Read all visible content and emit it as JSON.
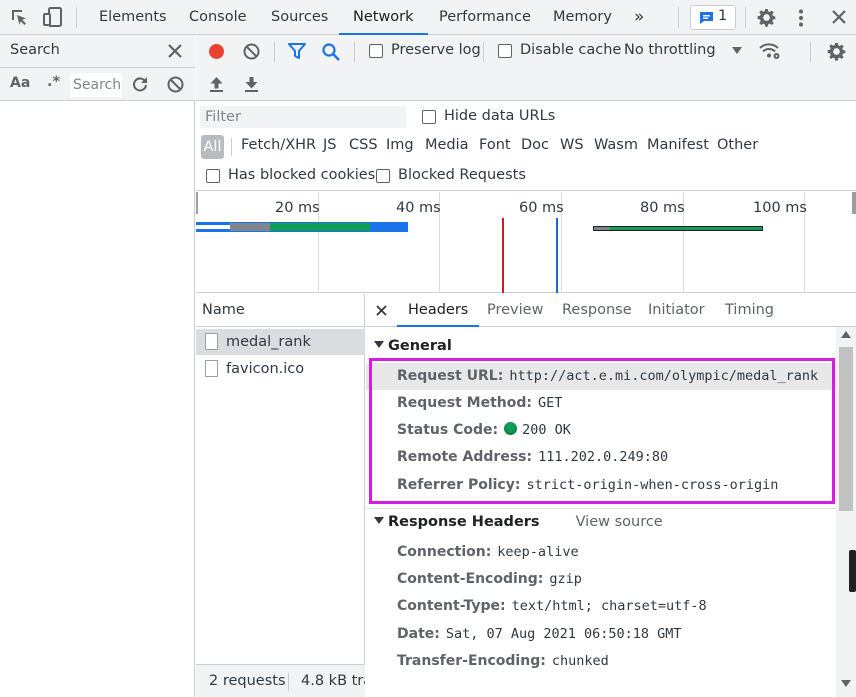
{
  "topbar": {
    "tabs": [
      "Elements",
      "Console",
      "Sources",
      "Network",
      "Performance",
      "Memory"
    ],
    "active_tab": "Network",
    "more": "»",
    "issues_count": "1"
  },
  "search_panel": {
    "title": "Search",
    "case_label": "Aa",
    "regex_label": ".*",
    "input_placeholder": "Search"
  },
  "toolbar": {
    "preserve_log": "Preserve log",
    "disable_cache": "Disable cache",
    "throttling": "No throttling"
  },
  "filter": {
    "placeholder": "Filter",
    "hide_data_urls": "Hide data URLs",
    "types": [
      "All",
      "Fetch/XHR",
      "JS",
      "CSS",
      "Img",
      "Media",
      "Font",
      "Doc",
      "WS",
      "Wasm",
      "Manifest",
      "Other"
    ],
    "has_blocked_cookies": "Has blocked cookies",
    "blocked_requests": "Blocked Requests"
  },
  "overview": {
    "ticks": [
      "20 ms",
      "40 ms",
      "60 ms",
      "80 ms",
      "100 ms"
    ],
    "colors": {
      "blue": "#1a73e8",
      "green": "#0f9d58",
      "grey": "#80868b",
      "red": "#c5221f",
      "line_blue": "#1967d2"
    }
  },
  "requests": {
    "header": "Name",
    "items": [
      "medal_rank",
      "favicon.ico"
    ],
    "status_requests": "2 requests",
    "status_transferred": "4.8 kB tra"
  },
  "details": {
    "tabs": [
      "Headers",
      "Preview",
      "Response",
      "Initiator",
      "Timing"
    ],
    "active_tab": "Headers",
    "general": {
      "title": "General",
      "rows": [
        {
          "name": "Request URL:",
          "value": "http://act.e.mi.com/olympic/medal_rank"
        },
        {
          "name": "Request Method:",
          "value": "GET"
        },
        {
          "name": "Status Code:",
          "value": "200 OK"
        },
        {
          "name": "Remote Address:",
          "value": "111.202.0.249:80"
        },
        {
          "name": "Referrer Policy:",
          "value": "strict-origin-when-cross-origin"
        }
      ]
    },
    "response_headers": {
      "title": "Response Headers",
      "view_source": "View source",
      "rows": [
        {
          "name": "Connection:",
          "value": "keep-alive"
        },
        {
          "name": "Content-Encoding:",
          "value": "gzip"
        },
        {
          "name": "Content-Type:",
          "value": "text/html; charset=utf-8"
        },
        {
          "name": "Date:",
          "value": "Sat, 07 Aug 2021 06:50:18 GMT"
        },
        {
          "name": "Transfer-Encoding:",
          "value": "chunked"
        }
      ]
    },
    "highlight_color": "#d81be0",
    "status_dot_color": "#0f9d58"
  }
}
